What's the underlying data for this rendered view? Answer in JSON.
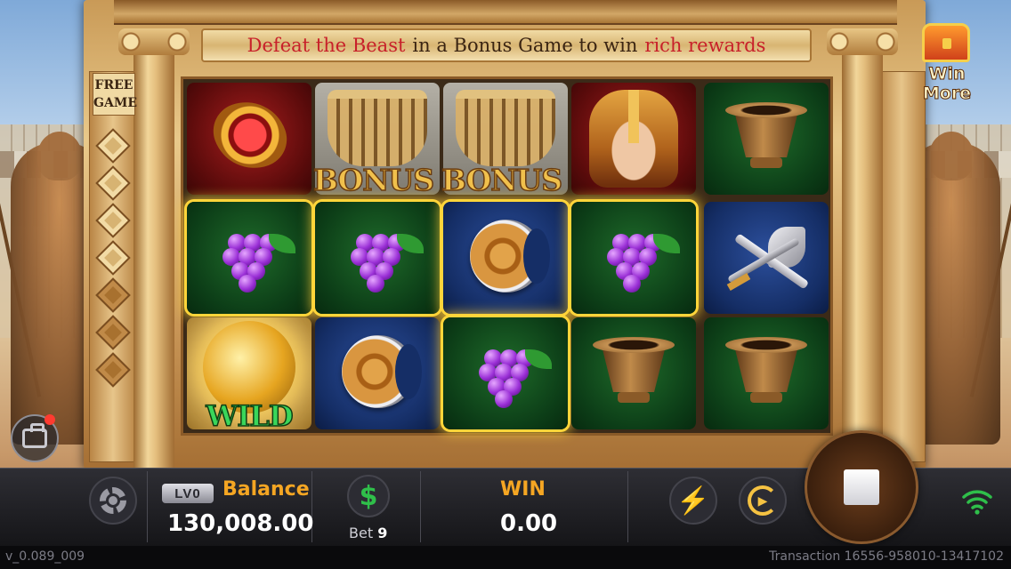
{
  "banner": {
    "part1": "Defeat the Beast",
    "part2": "in a Bonus Game to win",
    "part3": "rich rewards"
  },
  "free_game": {
    "label_line1": "FREE",
    "label_line2": "GAME"
  },
  "win_more": {
    "label": "Win More",
    "icon": "treasure-chest-icon"
  },
  "reels": {
    "symbols": [
      [
        "ruby-gem",
        "grapes",
        "golden-wild"
      ],
      [
        "colosseum-bonus",
        "grapes",
        "shield"
      ],
      [
        "colosseum-bonus",
        "shield",
        "grapes"
      ],
      [
        "warrior",
        "grapes",
        "bronze-cup"
      ],
      [
        "bronze-cup",
        "crossed-swords",
        "bronze-cup"
      ]
    ],
    "bonus_text_1": "BONUS",
    "bonus_text_2": "BONUS",
    "wild_text": "WILD"
  },
  "bottom_bar": {
    "level_badge": "LV0",
    "balance_label": "Balance",
    "balance_value": "130,008.00",
    "bet_icon": "$",
    "bet_label": "Bet",
    "bet_value": "9",
    "win_label": "WIN",
    "win_value": "0.00"
  },
  "footer": {
    "version": "v_0.089_009",
    "transaction": "Transaction 16556-958010-13417102"
  },
  "colors": {
    "accent_orange": "#f5a623",
    "win_highlight": "#ffd53a",
    "banner_highlight": "#c8202a"
  }
}
